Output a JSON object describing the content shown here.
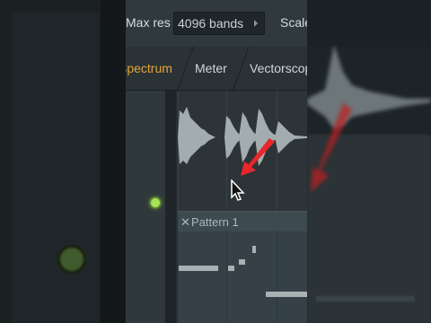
{
  "toolbar": {
    "max_res_label": "Max res",
    "max_res_value": "4096 bands",
    "scale_label": "Scale"
  },
  "tabs": [
    {
      "label": "Spectrum",
      "active": true
    },
    {
      "label": "Meter",
      "active": false
    },
    {
      "label": "Vectorscope",
      "active": false
    }
  ],
  "playlist": {
    "pattern_close_icon": "x-icon",
    "pattern_name": "Pattern 1"
  },
  "colors": {
    "active_tab": "#e6a43a",
    "led": "#a7e35a",
    "annotation_arrow": "#e8262b"
  }
}
